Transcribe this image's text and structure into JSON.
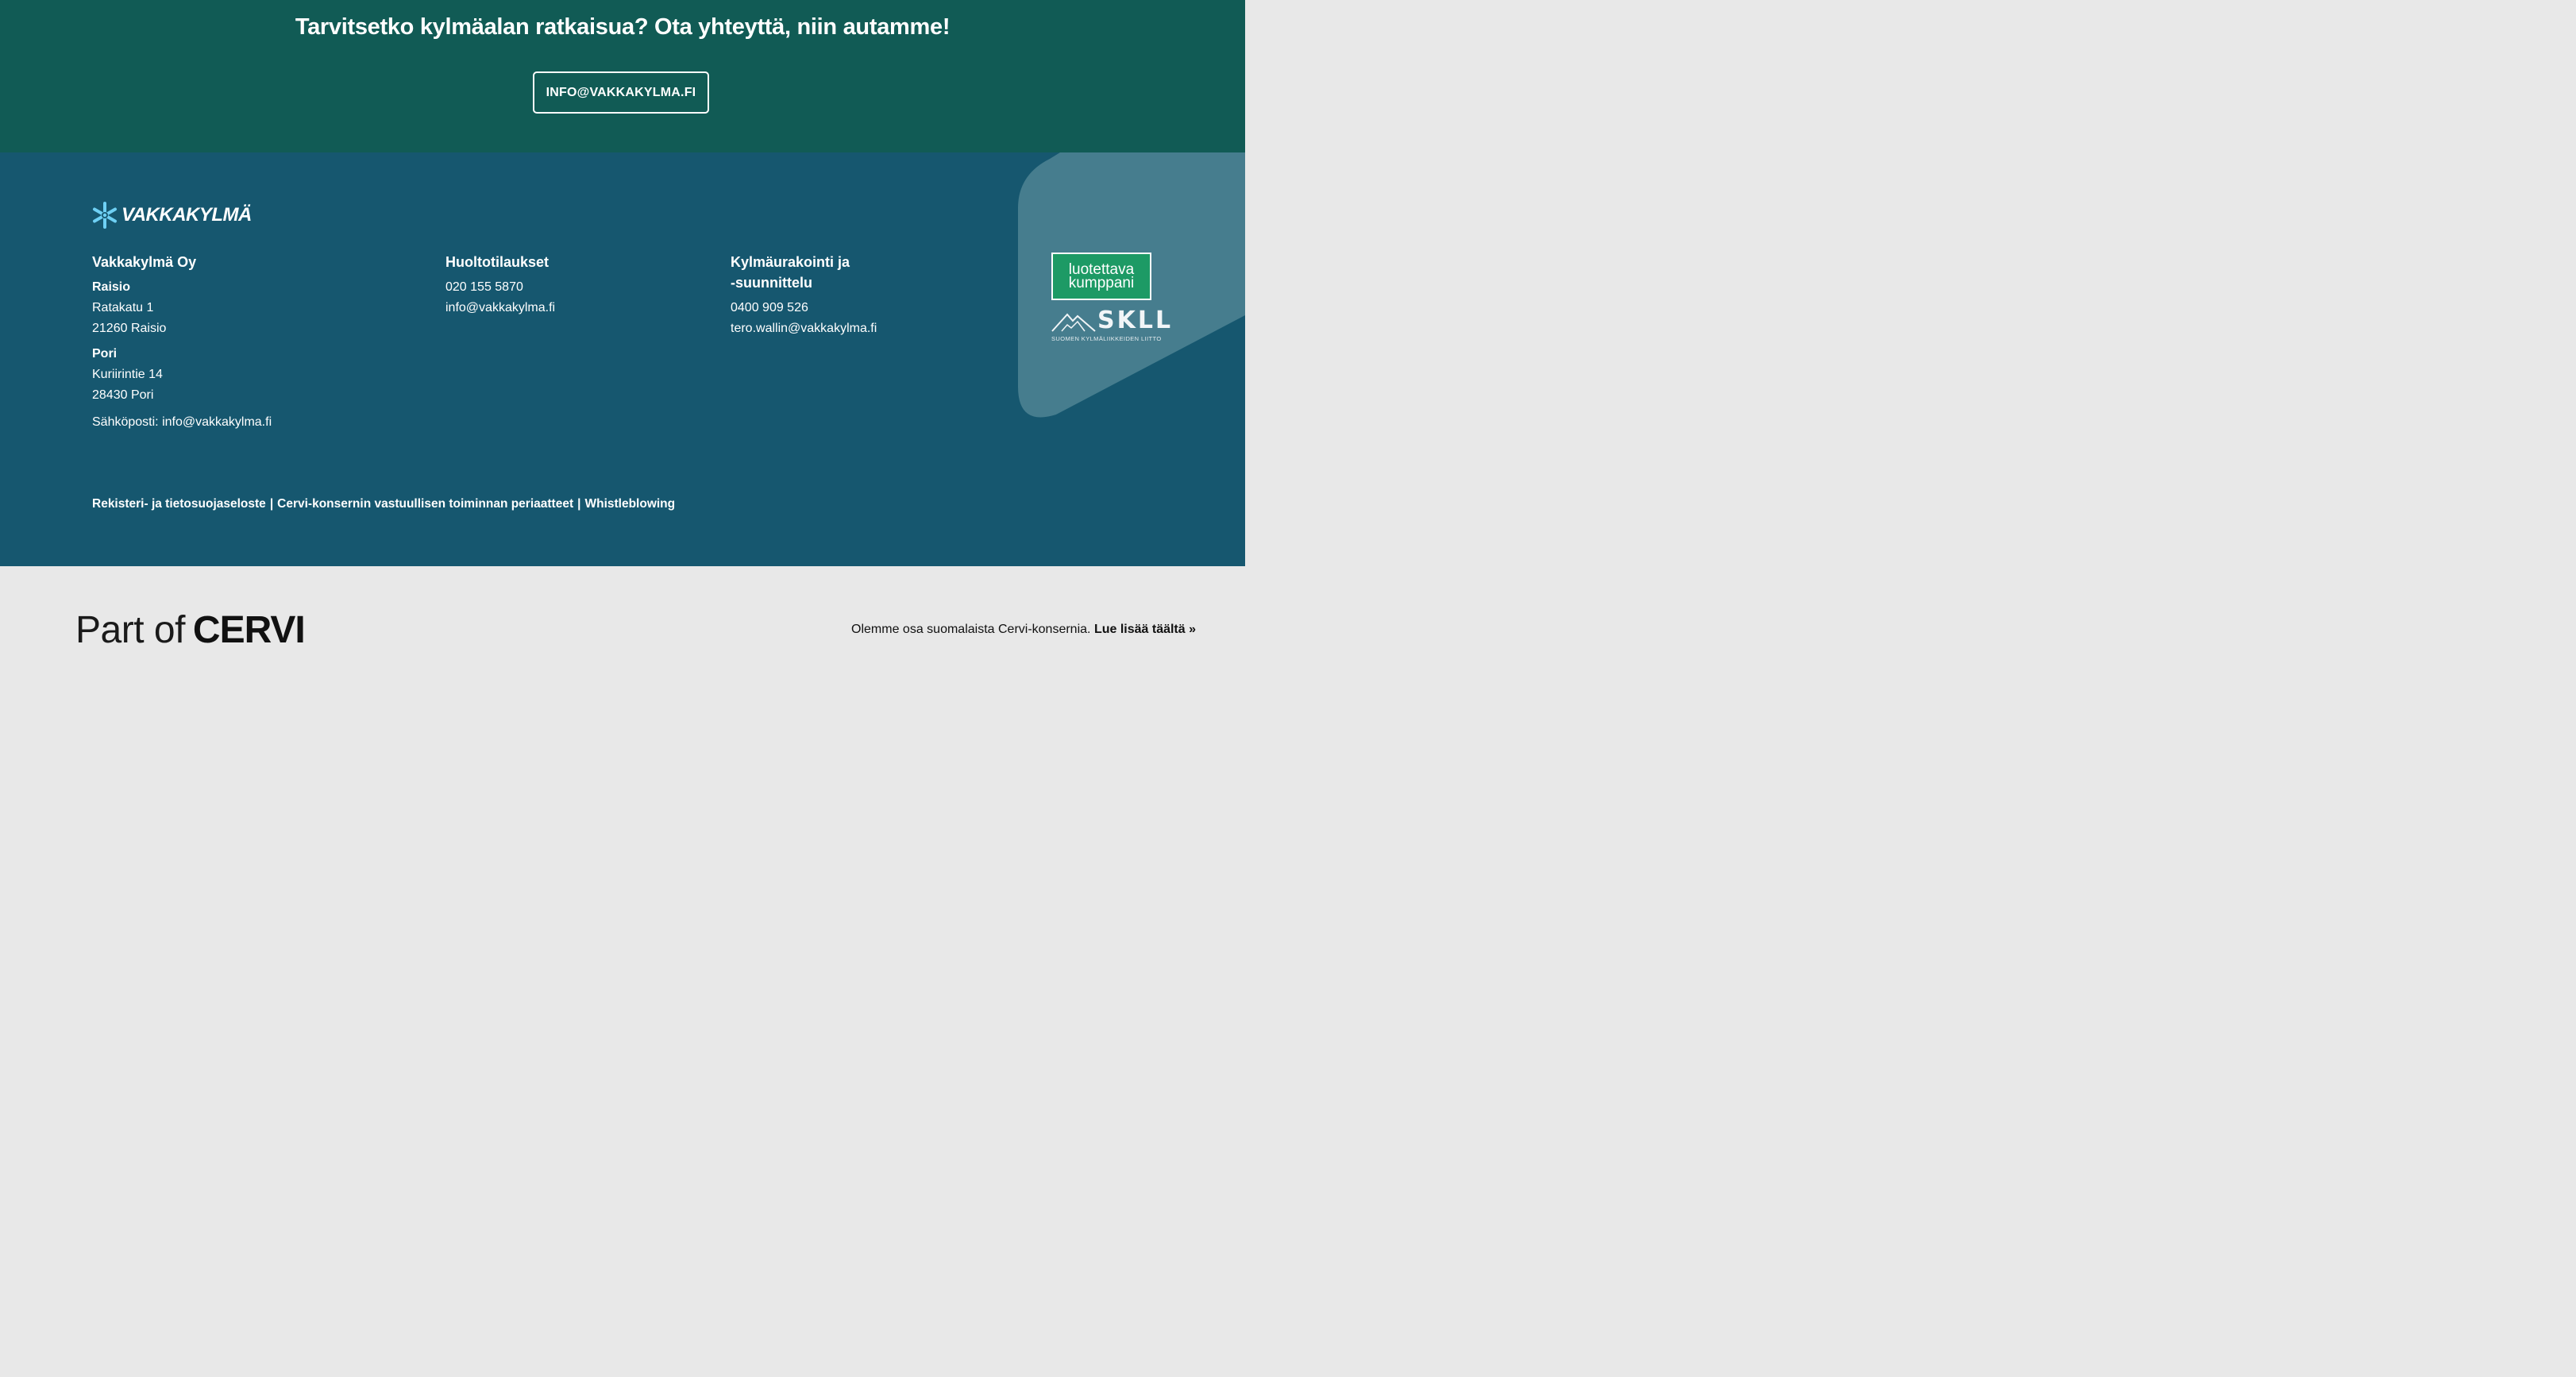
{
  "cta": {
    "title": "Tarvitsetko kylmäalan ratkaisua? Ota yhteyttä, niin autamme!",
    "button": "INFO@VAKKAKYLMA.FI"
  },
  "footer": {
    "logo": {
      "icon": "snowflake-icon",
      "text": "VAKKAKYLMÄ"
    },
    "company": {
      "name": "Vakkakylmä Oy",
      "offices": [
        {
          "city": "Raisio",
          "street": "Ratakatu 1",
          "postal": "21260 Raisio"
        },
        {
          "city": "Pori",
          "street": "Kuriirintie 14",
          "postal": "28430 Pori"
        }
      ],
      "email_label": "Sähköposti:",
      "email": "info@vakkakylma.fi"
    },
    "service": {
      "title": "Huoltotilaukset",
      "phone": "020 155 5870",
      "email": "info@vakkakylma.fi"
    },
    "contracting": {
      "title_line1": "Kylmäurakointi ja",
      "title_line2": "-suunnittelu",
      "phone": "0400 909 526",
      "email": "tero.wallin@vakkakylma.fi"
    },
    "legal": {
      "links": [
        "Rekisteri- ja tietosuojaseloste",
        "Cervi-konsernin vastuullisen toiminnan periaatteet",
        "Whistleblowing"
      ],
      "separator": "|"
    },
    "partner": {
      "badge_line1": "luotettava",
      "badge_line2": "kumppani",
      "skll_word": "SKLL",
      "skll_sub": "SUOMEN KYLMÄLIIKKEIDEN LIITTO"
    }
  },
  "cervi": {
    "logo_thin": "Part of",
    "logo_bold": "CERVI",
    "text": "Olemme osa suomalaista Cervi-konsernia.",
    "link": "Lue lisää täältä »"
  },
  "colors": {
    "cta_bg": "#115b55",
    "footer_bg": "#16576f",
    "badge_shape": "#467d8e",
    "partner_green": "#1d9a65",
    "cervi_bg": "#e8e8e8",
    "logo_snowflake": "#6ed0f4"
  }
}
